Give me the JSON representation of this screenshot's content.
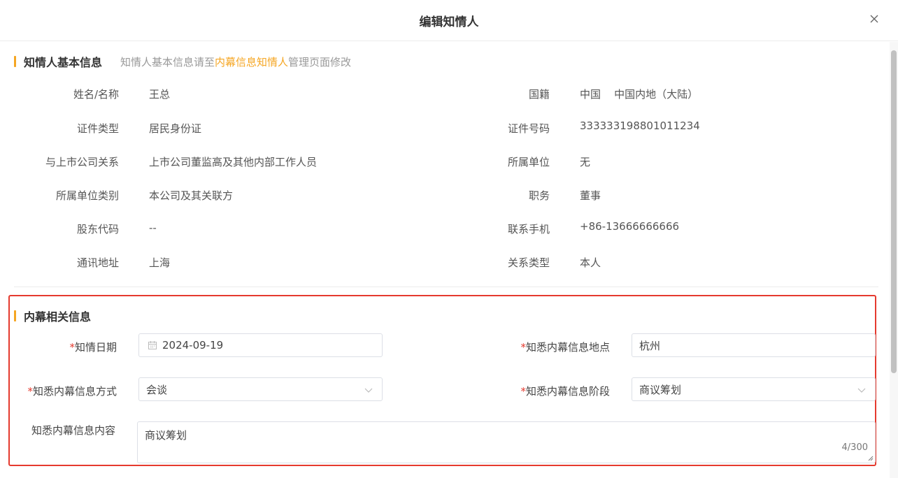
{
  "dialog": {
    "title": "编辑知情人"
  },
  "basic": {
    "title": "知情人基本信息",
    "hint_prefix": "知情人基本信息请至",
    "hint_link": "内幕信息知情人",
    "hint_suffix": "管理页面修改",
    "left": [
      {
        "label": "姓名/名称",
        "value": "王总"
      },
      {
        "label": "证件类型",
        "value": "居民身份证"
      },
      {
        "label": "与上市公司关系",
        "value": "上市公司董监高及其他内部工作人员"
      },
      {
        "label": "所属单位类别",
        "value": "本公司及其关联方"
      },
      {
        "label": "股东代码",
        "value": "--"
      },
      {
        "label": "通讯地址",
        "value": "上海"
      }
    ],
    "right": [
      {
        "label": "国籍",
        "value": "中国    中国内地（大陆）"
      },
      {
        "label": "证件号码",
        "value": "333333198801011234"
      },
      {
        "label": "所属单位",
        "value": "无"
      },
      {
        "label": "职务",
        "value": "董事"
      },
      {
        "label": "联系手机",
        "value": "+86-13666666666"
      },
      {
        "label": "关系类型",
        "value": "本人"
      }
    ]
  },
  "insider": {
    "title": "内幕相关信息",
    "required_mark": "*",
    "date_label": "知情日期",
    "date_value": "2024-09-19",
    "place_label": "知悉内幕信息地点",
    "place_value": "杭州",
    "method_label": "知悉内幕信息方式",
    "method_value": "会谈",
    "stage_label": "知悉内幕信息阶段",
    "stage_value": "商议筹划",
    "content_label": "知悉内幕信息内容",
    "content_value": "商议筹划",
    "content_counter": "4/300"
  },
  "colors": {
    "accent": "#f5a623",
    "required": "#e53a2e",
    "highlight_border": "#e53a2e"
  }
}
